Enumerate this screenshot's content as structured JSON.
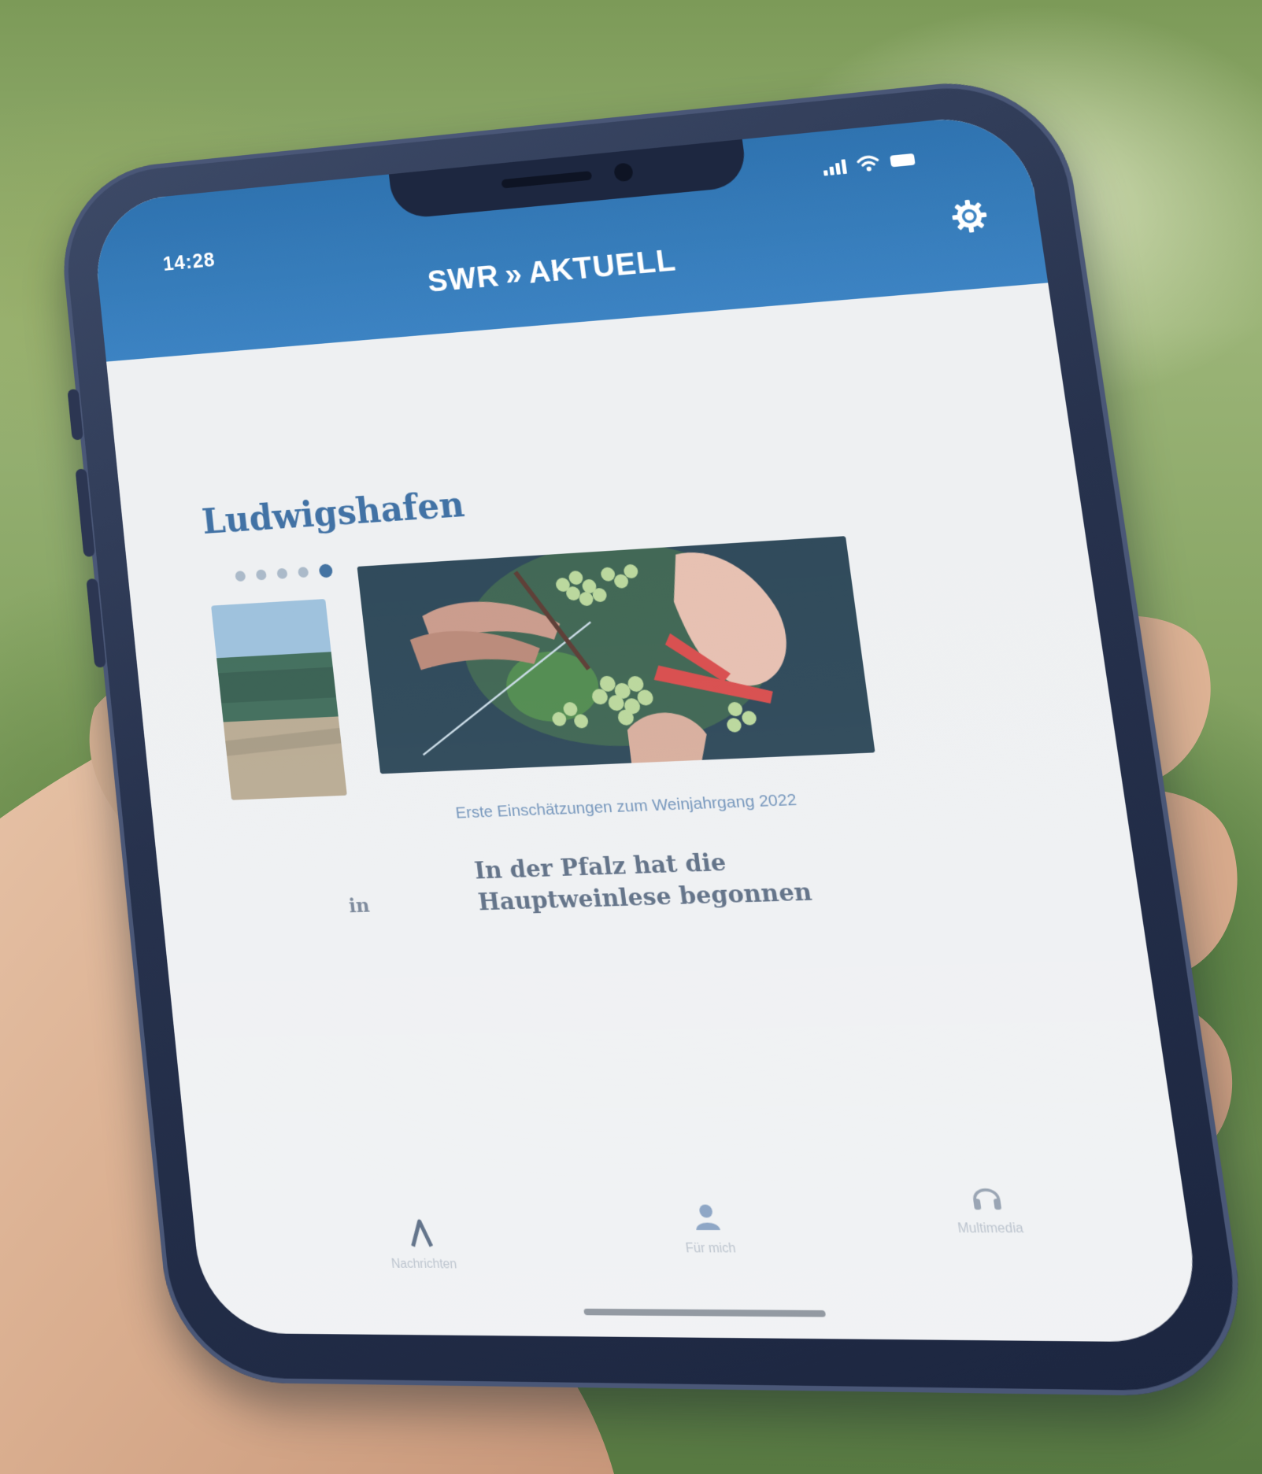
{
  "status_bar": {
    "time": "14:28",
    "icons": [
      "signal-icon",
      "wifi-icon",
      "battery-icon"
    ]
  },
  "header": {
    "brand_left": "SWR",
    "brand_mark": "»",
    "brand_right": "AKTUELL",
    "settings_icon": "gear-icon"
  },
  "content": {
    "region_title": "Ludwigshafen",
    "pager": {
      "total": 5,
      "active_index": 4
    },
    "previous_card_fragment": "in",
    "article": {
      "kicker": "Erste Einschätzungen zum Weinjahrgang 2022",
      "title": "In der Pfalz hat die Hauptweinlese begonnen"
    }
  },
  "bottom_nav": {
    "items": [
      {
        "label": "Nachrichten",
        "icon": "news-icon"
      },
      {
        "label": "Für mich",
        "icon": "person-icon"
      },
      {
        "label": "Multimedia",
        "icon": "headphones-icon"
      }
    ]
  },
  "colors": {
    "header_blue": "#3a82c2",
    "title_blue": "#3d6fa3",
    "screen_background": "#eef0f2",
    "phone_frame": "#27324d"
  }
}
